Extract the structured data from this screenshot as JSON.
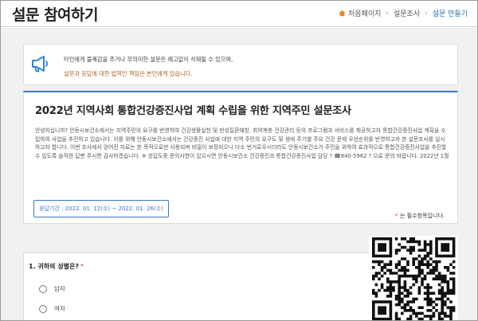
{
  "header": {
    "title": "설문 참여하기",
    "breadcrumb": [
      "처음페이지",
      "설문조사",
      "설문 만들기"
    ]
  },
  "notice": {
    "line1": "타인에게 불쾌감을 주거나 무의미한 설문은 예고없이 삭제될 수 있으며,",
    "line2": "설문과 응답에 대한 법적인 책임은 본인에게 있습니다."
  },
  "survey": {
    "title": "2022년 지역사회 통합건강증진사업 계획 수립을 위한 지역주민 설문조사",
    "description": "안녕하십니까? 안동시보건소에서는 지역주민의 요구를 반영하여 건강생활실천 및 만성질환예방, 취약계층 건강관리 등의 프로그램과 서비스를 제공하고자 통합건강증진사업 계획을 수립하여 사업을 추진하고 있습니다. 이를 위해 안동시보건소에서는 건강증진 사업에 대한 지역 주민의 요구도 및 생애 주기별 주요 건강 문제 우선순위를 반영하고자 본 설문조사를 실시하고자 합니다. 이번 조사에서 얻어진 자료는 본 목적으로만 사용되며 비밀이 보장되오니 다소 번거로우시더라도 안동시보건소가 주민을 위하여 효과적으로 통합건강증진사업을 추진할 수 있도록 솔직한 답변 주시면 감사하겠습니다. ※ 응답도중 문의사항이 있으시면 안동시보건소 건강증진과 통합건강증진사업 담당 ? ☎840-5962 ? 으로 문의 바랍니다. 2022년 1월",
    "period_label": "응답기간 : 2022. 01. 12(수) ~ 2022. 01. 26(수)",
    "required_mark": "*",
    "required_text": "는 필수항목입니다."
  },
  "question": {
    "title": "1. 귀하의 성별은?",
    "required_mark": "*",
    "options": [
      "남자",
      "여자"
    ]
  },
  "colors": {
    "accent": "#3b78c3",
    "warning": "#b5621e",
    "required": "#d23b3b",
    "background": "#f1f1f1"
  },
  "icons": {
    "breadcrumb_home": "home-icon",
    "notice": "megaphone-icon",
    "qr": "qr-code-image"
  }
}
